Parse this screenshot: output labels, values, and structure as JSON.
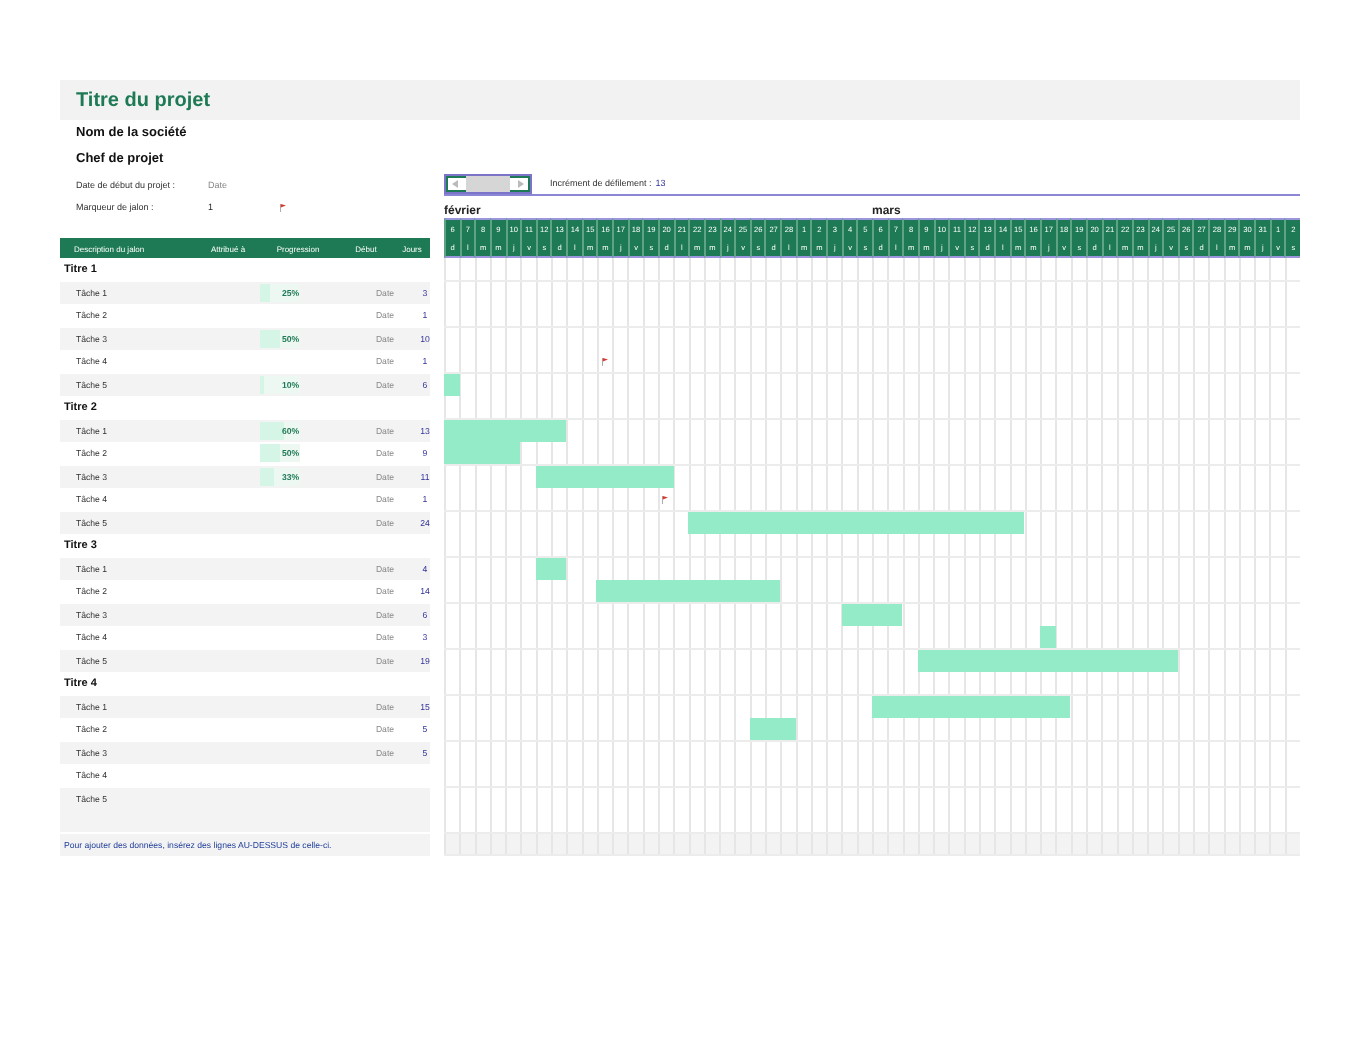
{
  "title": "Titre du projet",
  "company": "Nom de la société",
  "manager": "Chef de projet",
  "start_date": {
    "label": "Date de début du projet :",
    "value": "Date"
  },
  "milestone_marker": {
    "label": "Marqueur de jalon :",
    "value": "1"
  },
  "scroll": {
    "label": "Incrément de défilement :",
    "value": "13"
  },
  "columns": [
    "Description du jalon",
    "Attribué à",
    "Progression",
    "Début",
    "Jours"
  ],
  "days": [
    {
      "date": "6",
      "weekday": "d",
      "month": "février"
    },
    {
      "date": "7",
      "weekday": "l"
    },
    {
      "date": "8",
      "weekday": "m"
    },
    {
      "date": "9",
      "weekday": "m"
    },
    {
      "date": "10",
      "weekday": "j"
    },
    {
      "date": "11",
      "weekday": "v"
    },
    {
      "date": "12",
      "weekday": "s"
    },
    {
      "date": "13",
      "weekday": "d"
    },
    {
      "date": "14",
      "weekday": "l"
    },
    {
      "date": "15",
      "weekday": "m"
    },
    {
      "date": "16",
      "weekday": "m"
    },
    {
      "date": "17",
      "weekday": "j"
    },
    {
      "date": "18",
      "weekday": "v"
    },
    {
      "date": "19",
      "weekday": "s"
    },
    {
      "date": "20",
      "weekday": "d"
    },
    {
      "date": "21",
      "weekday": "l"
    },
    {
      "date": "22",
      "weekday": "m"
    },
    {
      "date": "23",
      "weekday": "m"
    },
    {
      "date": "24",
      "weekday": "j"
    },
    {
      "date": "25",
      "weekday": "v"
    },
    {
      "date": "26",
      "weekday": "s"
    },
    {
      "date": "27",
      "weekday": "d"
    },
    {
      "date": "28",
      "weekday": "l"
    },
    {
      "date": "1",
      "weekday": "m"
    },
    {
      "date": "2",
      "weekday": "m"
    },
    {
      "date": "3",
      "weekday": "j"
    },
    {
      "date": "4",
      "weekday": "v"
    },
    {
      "date": "5",
      "weekday": "s"
    },
    {
      "date": "6",
      "weekday": "d",
      "month": "mars"
    },
    {
      "date": "7",
      "weekday": "l"
    },
    {
      "date": "8",
      "weekday": "m"
    },
    {
      "date": "9",
      "weekday": "m"
    },
    {
      "date": "10",
      "weekday": "j"
    },
    {
      "date": "11",
      "weekday": "v"
    },
    {
      "date": "12",
      "weekday": "s"
    },
    {
      "date": "13",
      "weekday": "d"
    },
    {
      "date": "14",
      "weekday": "l"
    },
    {
      "date": "15",
      "weekday": "m"
    },
    {
      "date": "16",
      "weekday": "m"
    },
    {
      "date": "17",
      "weekday": "j"
    },
    {
      "date": "18",
      "weekday": "v"
    },
    {
      "date": "19",
      "weekday": "s"
    },
    {
      "date": "20",
      "weekday": "d"
    },
    {
      "date": "21",
      "weekday": "l"
    },
    {
      "date": "22",
      "weekday": "m"
    },
    {
      "date": "23",
      "weekday": "m"
    },
    {
      "date": "24",
      "weekday": "j"
    },
    {
      "date": "25",
      "weekday": "v"
    },
    {
      "date": "26",
      "weekday": "s"
    },
    {
      "date": "27",
      "weekday": "d"
    },
    {
      "date": "28",
      "weekday": "l"
    },
    {
      "date": "29",
      "weekday": "m"
    },
    {
      "date": "30",
      "weekday": "m"
    },
    {
      "date": "31",
      "weekday": "j"
    },
    {
      "date": "1",
      "weekday": "v"
    },
    {
      "date": "2",
      "weekday": "s"
    }
  ],
  "phases": [
    {
      "title": "Titre 1",
      "tasks": [
        {
          "name": "Tâche 1",
          "progress": "25%",
          "level": 0.25,
          "start": "Date",
          "days": "3"
        },
        {
          "name": "Tâche 2",
          "start": "Date",
          "days": "1"
        },
        {
          "name": "Tâche 3",
          "progress": "50%",
          "level": 0.5,
          "start": "Date",
          "days": "10"
        },
        {
          "name": "Tâche 4",
          "start": "Date",
          "days": "1"
        },
        {
          "name": "Tâche 5",
          "progress": "10%",
          "level": 0.1,
          "start": "Date",
          "days": "6"
        }
      ]
    },
    {
      "title": "Titre 2",
      "tasks": [
        {
          "name": "Tâche 1",
          "progress": "60%",
          "level": 0.6,
          "start": "Date",
          "days": "13"
        },
        {
          "name": "Tâche 2",
          "progress": "50%",
          "level": 0.5,
          "start": "Date",
          "days": "9"
        },
        {
          "name": "Tâche 3",
          "progress": "33%",
          "level": 0.33,
          "start": "Date",
          "days": "11"
        },
        {
          "name": "Tâche 4",
          "start": "Date",
          "days": "1"
        },
        {
          "name": "Tâche 5",
          "start": "Date",
          "days": "24"
        }
      ]
    },
    {
      "title": "Titre 3",
      "tasks": [
        {
          "name": "Tâche 1",
          "start": "Date",
          "days": "4"
        },
        {
          "name": "Tâche 2",
          "start": "Date",
          "days": "14"
        },
        {
          "name": "Tâche 3",
          "start": "Date",
          "days": "6"
        },
        {
          "name": "Tâche 4",
          "start": "Date",
          "days": "3"
        },
        {
          "name": "Tâche 5",
          "start": "Date",
          "days": "19"
        }
      ]
    },
    {
      "title": "Titre 4",
      "tasks": [
        {
          "name": "Tâche 1",
          "start": "Date",
          "days": "15"
        },
        {
          "name": "Tâche 2",
          "start": "Date",
          "days": "5"
        },
        {
          "name": "Tâche 3",
          "start": "Date",
          "days": "5"
        },
        {
          "name": "Tâche 4"
        },
        {
          "name": "Tâche 5"
        }
      ]
    }
  ],
  "footer_note": "Pour ajouter des données, insérez des lignes AU-DESSUS de celle-ci."
}
